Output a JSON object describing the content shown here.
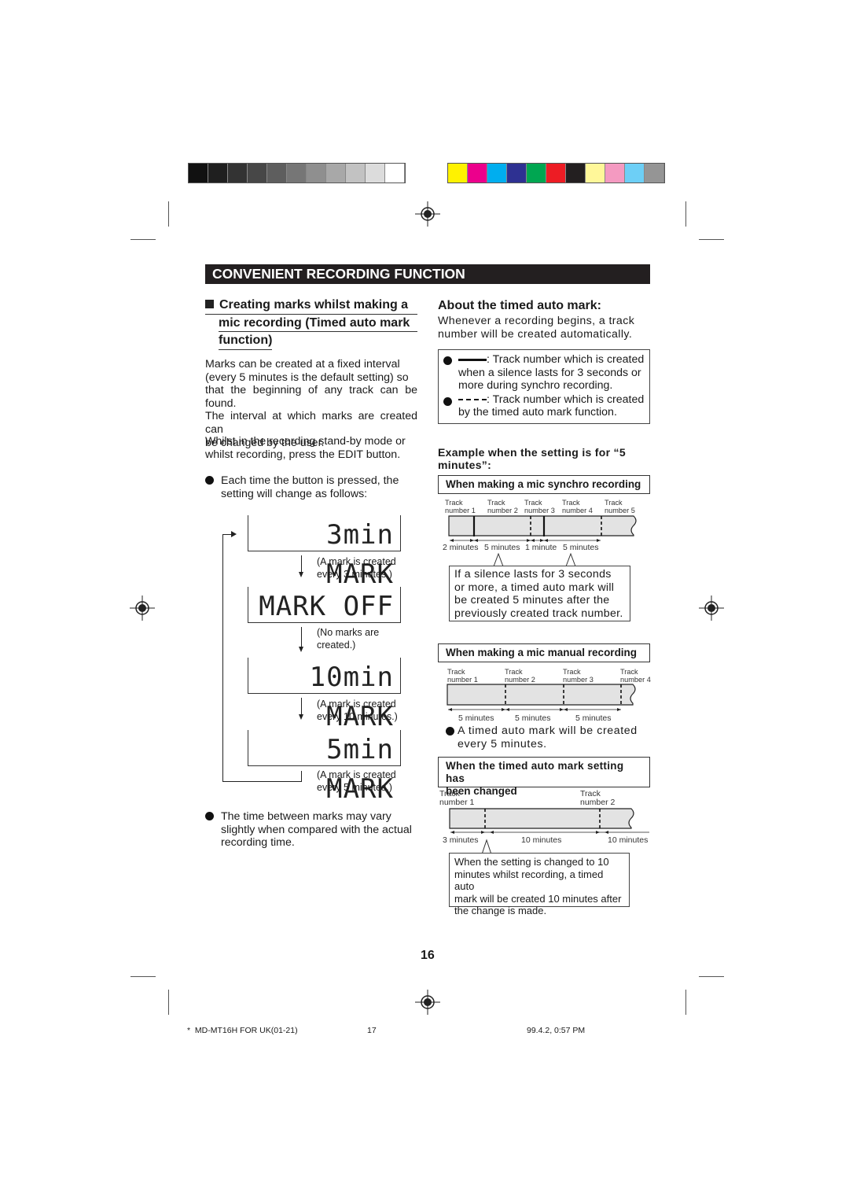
{
  "color_bars": {
    "grayscale": [
      "#111111",
      "#1f1f1f",
      "#333333",
      "#474747",
      "#5e5e5e",
      "#767676",
      "#8f8f8f",
      "#a8a8a8",
      "#c2c2c2",
      "#dcdcdc",
      "#ffffff"
    ],
    "colors": [
      "#fff200",
      "#ec008c",
      "#00aeef",
      "#2e3192",
      "#00a651",
      "#ed1c24",
      "#231f20",
      "#fff799",
      "#f49ac1",
      "#6dcff6",
      "#959595"
    ]
  },
  "header": {
    "title": "CONVENIENT RECORDING FUNCTION"
  },
  "left": {
    "section_title": [
      "Creating marks whilst making a",
      "mic recording (Timed auto mark",
      "function)"
    ],
    "para1": [
      "Marks can be created at a fixed interval",
      "(every 5 minutes is the default setting) so",
      "that the beginning of any track can be found.",
      "The interval at which marks are created can",
      "be changed by the user."
    ],
    "para2": [
      "Whilst in the recording stand-by mode or",
      "whilst recording, press the EDIT button."
    ],
    "bullet1": [
      "Each time the button is pressed, the",
      "setting will change as follows:"
    ],
    "displays": [
      {
        "text": "3min MARK",
        "note": [
          "(A mark is created",
          "every 3 minutes.)"
        ]
      },
      {
        "text": "MARK OFF",
        "note": [
          "(No marks are",
          "created.)"
        ]
      },
      {
        "text": "10min MARK",
        "note": [
          "(A mark is created",
          "every 10 minutes.)"
        ]
      },
      {
        "text": "5min MARK",
        "note": [
          "(A mark is created",
          "every 5 minutes.)"
        ]
      }
    ],
    "bullet2": [
      "The time between marks may vary",
      "slightly when compared with the actual",
      "recording time."
    ]
  },
  "right": {
    "about_title": "About the timed auto mark:",
    "about_text": [
      "Whenever a recording begins, a track",
      "number will be created automatically."
    ],
    "legend": {
      "solid": [
        ": Track number which is created",
        "when a silence lasts for 3 seconds or",
        "more during synchro recording."
      ],
      "dashed": [
        ": Track number which is created",
        "by the timed auto mark function."
      ]
    },
    "example_title": [
      "Example when the setting is for “5",
      "minutes”:"
    ],
    "synchro": {
      "title": "When making a mic synchro recording",
      "tracks": [
        [
          "Track",
          "number 1"
        ],
        [
          "Track",
          "number 2"
        ],
        [
          "Track",
          "number 3"
        ],
        [
          "Track",
          "number 4"
        ],
        [
          "Track",
          "number 5"
        ]
      ],
      "durations": [
        "2 minutes",
        "5 minutes",
        "1 minute",
        "5 minutes"
      ],
      "callout": [
        "If a silence lasts for 3 seconds",
        "or more, a timed auto mark will",
        "be created 5 minutes after the",
        "previously created track number."
      ]
    },
    "manual": {
      "title": "When making a mic manual recording",
      "tracks": [
        [
          "Track",
          "number 1"
        ],
        [
          "Track",
          "number 2"
        ],
        [
          "Track",
          "number 3"
        ],
        [
          "Track",
          "number 4"
        ]
      ],
      "durations": [
        "5 minutes",
        "5 minutes",
        "5 minutes"
      ],
      "note": [
        "A timed auto mark will be created",
        "every 5 minutes."
      ]
    },
    "changed": {
      "title": [
        "When the timed auto mark setting has",
        "been changed"
      ],
      "tracks": [
        [
          "Track",
          "number 1"
        ],
        [
          "Track",
          "number 2"
        ]
      ],
      "durations": [
        "3 minutes",
        "10 minutes",
        "10 minutes"
      ],
      "callout": [
        "When the setting is changed to 10",
        "minutes whilst recording, a timed auto",
        "mark will be created 10 minutes after",
        "the change is made."
      ]
    }
  },
  "page_number": "16",
  "footer": {
    "file": "MD-MT16H FOR UK(01-21)",
    "page": "17",
    "date": "99.4.2, 0:57 PM"
  }
}
